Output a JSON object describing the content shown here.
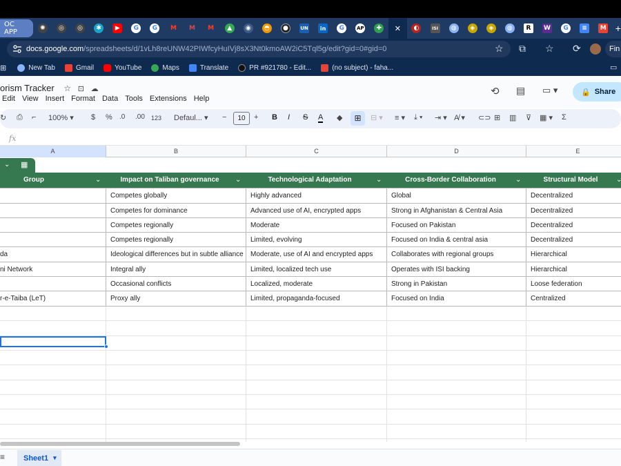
{
  "browser": {
    "tab_app_label": "OC APP",
    "close_tab_glyph": "✕",
    "new_tab_glyph": "+",
    "profile_label": "Fin",
    "url_host": "docs.google.com",
    "url_path": "/spreadsheets/d/1vLh8reUNW42PIWfcyHuIVj8sX3Nt0kmoAW2iC5Tql5g/edit?gid=0#gid=0",
    "bookmarks": [
      {
        "label": "New Tab",
        "icon": "globe-icon",
        "color": "#8ab4f8"
      },
      {
        "label": "Gmail",
        "icon": "gmail-icon",
        "color": "#ea4335"
      },
      {
        "label": "YouTube",
        "icon": "youtube-icon",
        "color": "#ff0000"
      },
      {
        "label": "Maps",
        "icon": "maps-icon",
        "color": "#34a853"
      },
      {
        "label": "Translate",
        "icon": "translate-icon",
        "color": "#4285f4"
      },
      {
        "label": "PR #921780 - Edit...",
        "icon": "github-icon",
        "color": "#111111"
      },
      {
        "label": "(no subject) - faha...",
        "icon": "gmail-icon",
        "color": "#ea4335"
      }
    ]
  },
  "doc": {
    "title": "orism Tracker",
    "menus": [
      "Edit",
      "View",
      "Insert",
      "Format",
      "Data",
      "Tools",
      "Extensions",
      "Help"
    ],
    "share_label": "Share"
  },
  "toolbar": {
    "zoom": "100%",
    "currency": "$",
    "percent": "%",
    "dec_less": ".0",
    "dec_more": ".00",
    "number_format": "123",
    "font": "Defaul...",
    "font_size": "10",
    "minus": "−",
    "plus": "+",
    "bold": "B",
    "italic": "I",
    "strike": "S",
    "text_color": "A",
    "sum": "Σ"
  },
  "formula_bar": {
    "fx": "fx"
  },
  "columns": [
    "A",
    "B",
    "C",
    "D",
    "E"
  ],
  "table": {
    "headers": [
      "Group",
      "Impact on Taliban governance",
      "Technological Adaptation",
      "Cross-Border Collaboration",
      "Structural Model"
    ],
    "header_color": "#36784f",
    "rows": [
      [
        "",
        "Competes globally",
        "Highly advanced",
        "Global",
        "Decentralized"
      ],
      [
        "",
        "Competes for dominance",
        "Advanced use of AI, encrypted apps",
        "Strong in Afghanistan & Central Asia",
        "Decentralized"
      ],
      [
        "",
        "Competes regionally",
        "Moderate",
        "Focused on Pakistan",
        "Decentralized"
      ],
      [
        "",
        "Competes regionally",
        "Limited, evolving",
        "Focused on India & central asia",
        "Decentralized"
      ],
      [
        "da",
        "Ideological differences but in subtle alliance",
        "Moderate, use of AI and encrypted apps",
        "Collaborates with regional groups",
        "Hierarchical"
      ],
      [
        "ni Network",
        "Integral ally",
        "Limited, localized tech use",
        "Operates with ISI backing",
        "Hierarchical"
      ],
      [
        "",
        "Occasional conflicts",
        "Localized, moderate",
        "Strong in Pakistan",
        "Loose federation"
      ],
      [
        "r-e-Taiba (LeT)",
        "Proxy ally",
        "Limited, propaganda-focused",
        "Focused on India",
        "Centralized"
      ]
    ]
  },
  "sheet": {
    "tab_label": "Sheet1"
  }
}
